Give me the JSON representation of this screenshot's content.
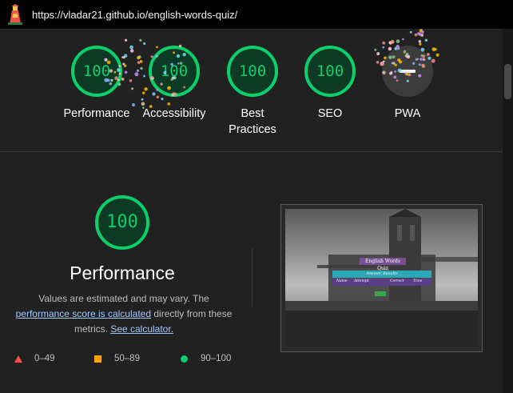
{
  "browser": {
    "url": "https://vladar21.github.io/english-words-quiz/"
  },
  "top_gauges": [
    {
      "label": "Performance",
      "score": "100"
    },
    {
      "label": "Accessibility",
      "score": "100"
    },
    {
      "label": "Best Practices",
      "score": "100"
    },
    {
      "label": "SEO",
      "score": "100"
    },
    {
      "label": "PWA",
      "score": null
    }
  ],
  "performance": {
    "score": "100",
    "title": "Performance",
    "desc_before": "Values are estimated and may vary. The",
    "desc_link1": "performance score is calculated",
    "desc_mid": "directly from these metrics.",
    "desc_link2": "See calculator."
  },
  "legend": [
    {
      "range": "0–49",
      "shape": "triangle",
      "color": "#ff4e42"
    },
    {
      "range": "50–89",
      "shape": "square",
      "color": "#ffa400"
    },
    {
      "range": "90–100",
      "shape": "circle",
      "color": "#0cce6b"
    }
  ],
  "thumbnail": {
    "quiz_title": "English Words Quiz",
    "quiz_subtitle": "Answer Results",
    "row": [
      "Name",
      "Attempt",
      "Correct",
      "Time"
    ]
  },
  "colors": {
    "pass": "#0cce6b",
    "background": "#212121"
  }
}
